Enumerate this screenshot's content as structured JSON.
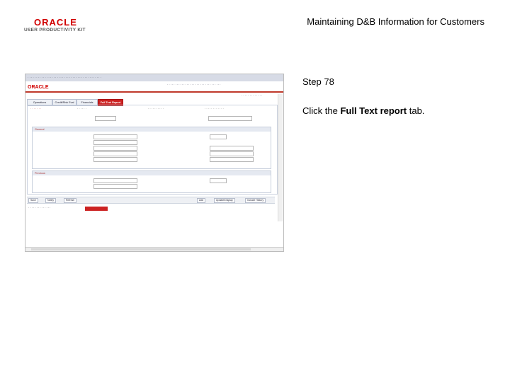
{
  "header": {
    "logo_brand": "ORACLE",
    "logo_sub": "USER PRODUCTIVITY KIT",
    "doc_title": "Maintaining D&B Information for Customers"
  },
  "screenshot": {
    "oracle_text": "ORACLE",
    "tabs": [
      "Operations",
      "Credit/Risk Eval",
      "Financials",
      "Full Text Report"
    ],
    "active_tab": "Full Text Report",
    "sections": [
      "General",
      "Previous"
    ],
    "buttons": [
      "Save",
      "Notify",
      "Refresh",
      "Add",
      "Update/Display",
      "Include History"
    ]
  },
  "step": {
    "label": "Step 78"
  },
  "instruction": {
    "prefix": "Click the ",
    "target": "Full Text report",
    "suffix": " tab."
  }
}
